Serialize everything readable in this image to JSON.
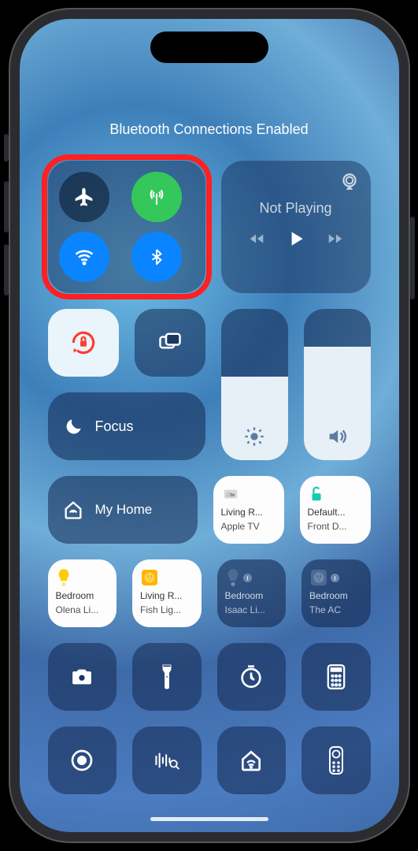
{
  "status_banner": "Bluetooth Connections Enabled",
  "connectivity": {
    "airplane_on": false,
    "cellular_on": true,
    "wifi_on": true,
    "bluetooth_on": true,
    "highlighted": true
  },
  "media": {
    "title": "Not Playing"
  },
  "focus": {
    "label": "Focus"
  },
  "orientation_lock_on": true,
  "brightness_pct": 55,
  "volume_pct": 75,
  "home": {
    "label": "My Home"
  },
  "accessories_row1": [
    {
      "line1": "Living R...",
      "line2": "Apple TV",
      "appearance": "white",
      "icon": "appletv"
    },
    {
      "line1": "Default...",
      "line2": "Front D...",
      "appearance": "white",
      "icon": "lock"
    }
  ],
  "accessories_row2": [
    {
      "line1": "Bedroom",
      "line2": "Olena Li...",
      "appearance": "white",
      "icon": "bulb-yellow"
    },
    {
      "line1": "Living R...",
      "line2": "Fish Lig...",
      "appearance": "white",
      "icon": "outlet-yellow"
    },
    {
      "line1": "Bedroom",
      "line2": "Isaac Li...",
      "appearance": "dark",
      "icon": "bulb-dim"
    },
    {
      "line1": "Bedroom",
      "line2": "The AC",
      "appearance": "dark",
      "icon": "outlet-dim"
    }
  ]
}
